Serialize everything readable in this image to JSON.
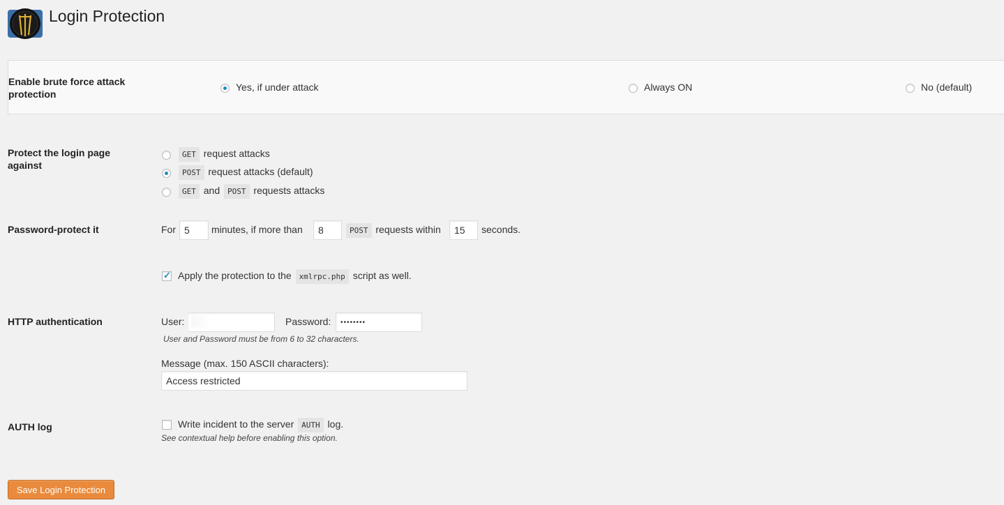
{
  "page": {
    "title": "Login Protection",
    "logo_icon": "ninjafirewall-logo-icon"
  },
  "brute_force": {
    "label": "Enable brute force attack protection",
    "options": [
      "Yes, if under attack",
      "Always ON",
      "No (default)"
    ],
    "selected": "Yes, if under attack"
  },
  "protect": {
    "label": "Protect the login page against",
    "opt1": {
      "code": "GET",
      "text": "request attacks"
    },
    "opt2": {
      "code": "POST",
      "text": "request attacks (default)"
    },
    "opt3": {
      "code1": "GET",
      "and": "and",
      "code2": "POST",
      "text": "requests attacks"
    },
    "selected": "POST request attacks (default)"
  },
  "password_protect": {
    "label": "Password-protect it",
    "for": "For",
    "minutes": "5",
    "minutes_text": "minutes, if more than",
    "requests": "8",
    "code": "POST",
    "within_text": "requests within",
    "seconds": "15",
    "seconds_text": "seconds."
  },
  "xmlrpc": {
    "checked": true,
    "text_before": "Apply the protection to the",
    "code": "xmlrpc.php",
    "text_after": "script as well."
  },
  "http_auth": {
    "label": "HTTP authentication",
    "user_label": "User:",
    "user_value": "",
    "password_label": "Password:",
    "password_value": "••••••••",
    "hint": "User and Password must be from 6 to 32 characters.",
    "message_label": "Message (max. 150 ASCII characters):",
    "message_value": "Access restricted"
  },
  "auth_log": {
    "label": "AUTH log",
    "checked": false,
    "text_before": "Write incident to the server",
    "code": "AUTH",
    "text_after": "log.",
    "hint": "See contextual help before enabling this option."
  },
  "save_button": "Save Login Protection",
  "colors": {
    "accent": "#1e8cbe",
    "button": "#e98a3c"
  }
}
